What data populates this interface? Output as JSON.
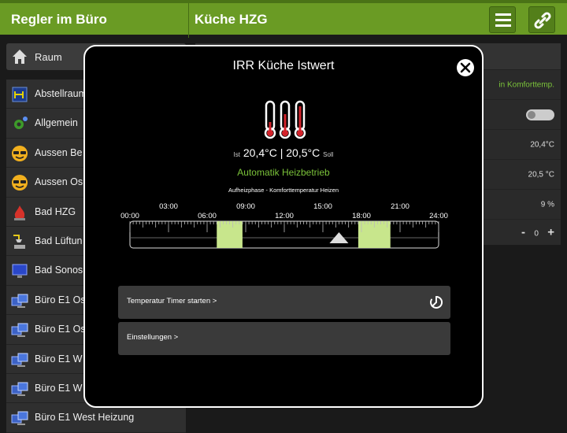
{
  "header": {
    "left_title": "Regler im Büro",
    "right_title": "Küche HZG"
  },
  "sidebar": {
    "raum_label": "Raum",
    "items": [
      {
        "label": "Abstellraum",
        "icon": "abstellraum-icon"
      },
      {
        "label": "Allgemein",
        "icon": "gear-icon"
      },
      {
        "label": "Aussen Be",
        "icon": "sunglasses-icon"
      },
      {
        "label": "Aussen Os",
        "icon": "sunglasses-icon"
      },
      {
        "label": "Bad HZG",
        "icon": "fire-icon"
      },
      {
        "label": "Bad Lüftun",
        "icon": "shower-icon"
      },
      {
        "label": "Bad Sonos",
        "icon": "monitor-icon"
      },
      {
        "label": "Büro E1 Os",
        "icon": "computer-icon"
      },
      {
        "label": "Büro E1 Os",
        "icon": "computer-icon"
      },
      {
        "label": "Büro E1 W",
        "icon": "computer-icon"
      },
      {
        "label": "Büro E1 W",
        "icon": "computer-icon"
      },
      {
        "label": "Büro E1 West Heizung",
        "icon": "computer-icon"
      }
    ]
  },
  "right_panel": {
    "status": "in Komforttemp.",
    "istwert": "20,4°C",
    "sollwert": "20,5 °C",
    "stellwert": "9 %",
    "stepper": {
      "minus": "-",
      "value": "0",
      "plus": "+"
    }
  },
  "modal": {
    "title": "IRR Küche Istwert",
    "ist_label": "Ist",
    "ist_value": "20,4°C",
    "separator": "|",
    "soll_value": "20,5°C",
    "soll_label": "Soll",
    "mode": "Automatik Heizbetrieb",
    "phase": "Aufheizphase - Komforttemperatur Heizen",
    "timeline": {
      "hours_top": [
        "03:00",
        "09:00",
        "15:00",
        "21:00"
      ],
      "hours_bottom": [
        "00:00",
        "06:00",
        "12:00",
        "18:00",
        "24:00"
      ],
      "comfort_blocks_hours": [
        [
          6.75,
          8.75
        ],
        [
          17.75,
          20.25
        ]
      ],
      "current_hour": 16.25,
      "comfort_color": "#c8e68c"
    },
    "buttons": [
      {
        "label": "Temperatur Timer starten >",
        "icon": "timer-icon"
      },
      {
        "label": "Einstellungen >"
      }
    ]
  },
  "colors": {
    "accent": "#6a9b24",
    "green_text": "#7bc33a"
  }
}
